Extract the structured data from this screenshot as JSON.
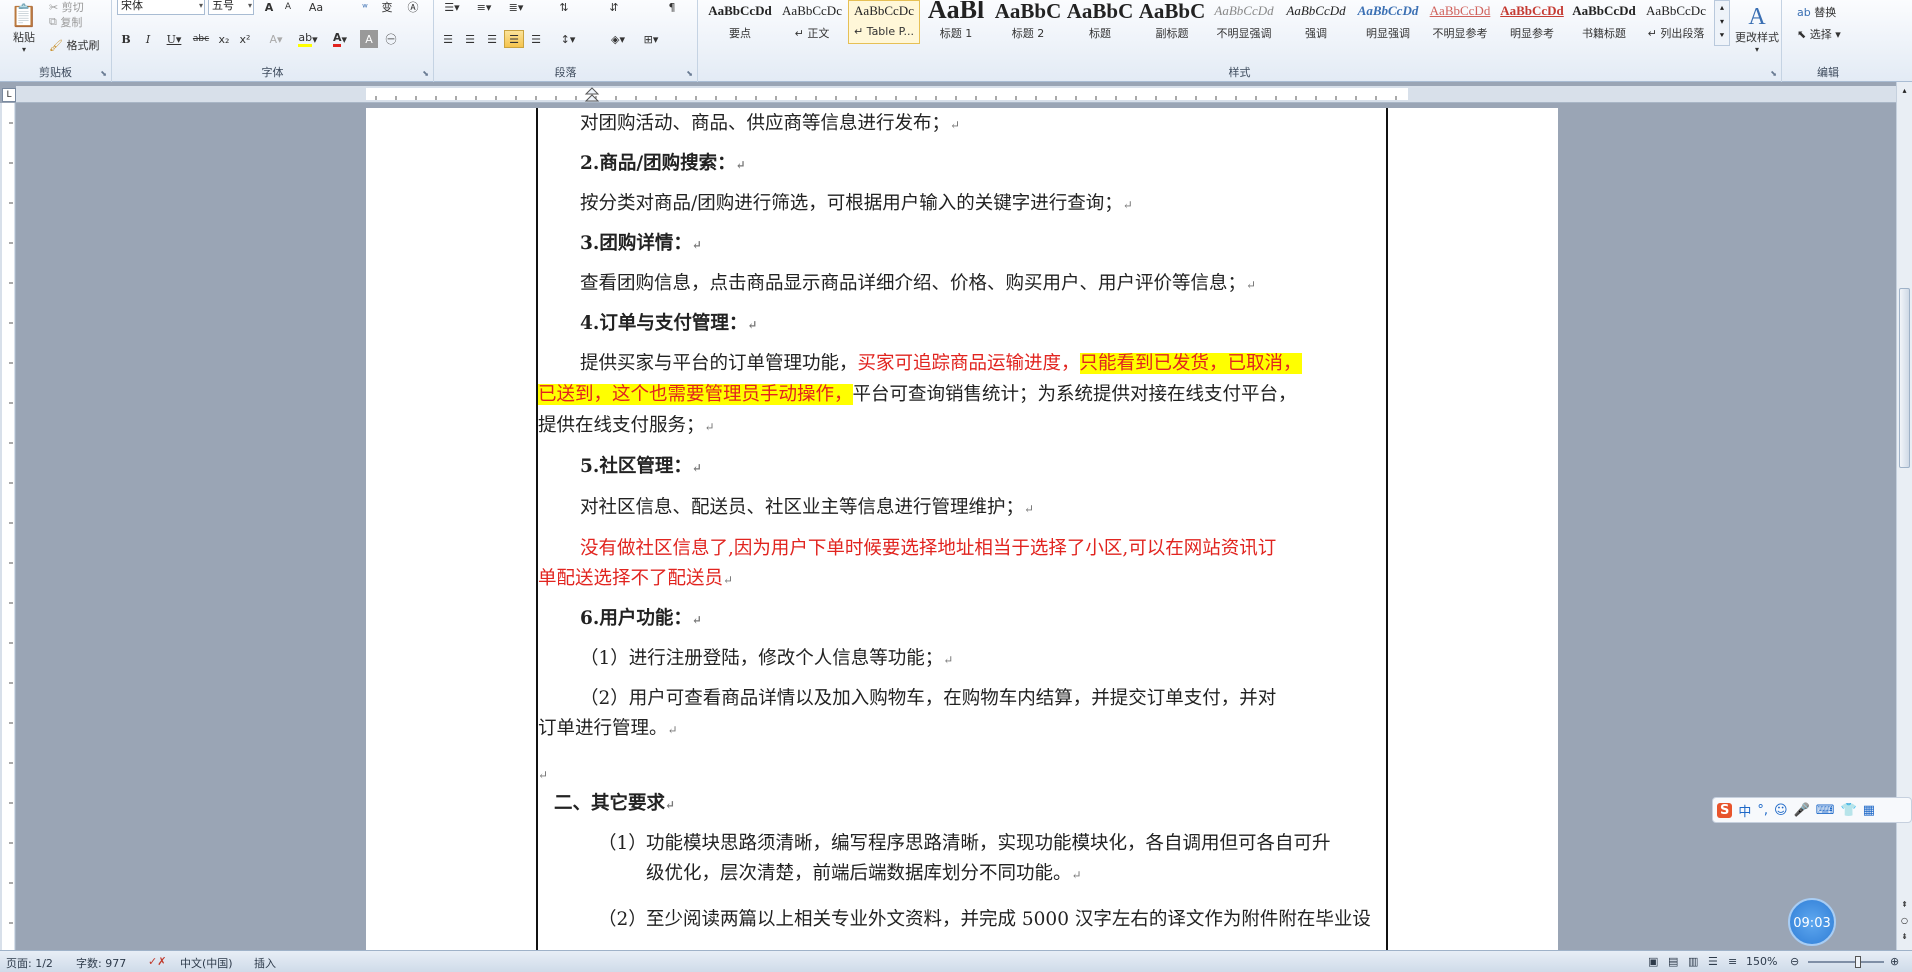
{
  "ribbon": {
    "clipboard": {
      "label": "剪贴板",
      "paste": "粘贴",
      "cut": "剪切",
      "copy": "复制",
      "format_painter": "格式刷"
    },
    "font": {
      "label": "字体",
      "family": "宋体",
      "size": "五号"
    },
    "paragraph": {
      "label": "段落"
    },
    "styles": {
      "label": "样式",
      "items": [
        {
          "preview": "AaBbCcDd",
          "name": "要点"
        },
        {
          "preview": "AaBbCcDc",
          "name": "↵ 正文"
        },
        {
          "preview": "AaBbCcDc",
          "name": "↵ Table P..."
        },
        {
          "preview": "AaBl",
          "name": "标题 1"
        },
        {
          "preview": "AaBbC",
          "name": "标题 2"
        },
        {
          "preview": "AaBbC",
          "name": "标题"
        },
        {
          "preview": "AaBbC",
          "name": "副标题"
        },
        {
          "preview": "AaBbCcDd",
          "name": "不明显强调"
        },
        {
          "preview": "AaBbCcDd",
          "name": "强调"
        },
        {
          "preview": "AaBbCcDd",
          "name": "明显强调"
        },
        {
          "preview": "AaBbCcDd",
          "name": "不明显参考"
        },
        {
          "preview": "AaBbCcDd",
          "name": "明显参考"
        },
        {
          "preview": "AaBbCcDd",
          "name": "书籍标题"
        },
        {
          "preview": "AaBbCcDc",
          "name": "↵ 列出段落"
        }
      ],
      "change_styles": "更改样式"
    },
    "editing": {
      "label": "编辑",
      "replace": "替换",
      "select": "选择"
    }
  },
  "document": {
    "lines": [
      "对团购活动、商品、供应商等信息进行发布；",
      "2.商品/团购搜索：",
      "按分类对商品/团购进行筛选，可根据用户输入的关键字进行查询；",
      "3.团购详情：",
      "查看团购信息，点击商品显示商品详细介绍、价格、购买用户、用户评价等信息；",
      "4.订单与支付管理：",
      "提供买家与平台的订单管理功能，",
      "买家可追踪商品运输进度，",
      "只能看到已发货，已取消，",
      "已送到，这个也需要管理员手动操作，",
      "平台可查询销售统计；为系统提供对接在线支付平台，",
      "提供在线支付服务；",
      "5.社区管理：",
      "对社区信息、配送员、社区业主等信息进行管理维护；",
      "没有做社区信息了,因为用户下单时候要选择地址相当于选择了小区,可以在网站资讯订",
      "单配送选择不了配送员",
      "6.用户功能：",
      "（1）进行注册登陆，修改个人信息等功能；",
      "（2）用户可查看商品详情以及加入购物车，在购物车内结算，并提交订单支付，并对",
      "订单进行管理。",
      "二、其它要求",
      "（1）",
      "功能模块思路须清晰，编写程序思路清晰，实现功能模块化，各自调用但可各自可升",
      "级优化，层次清楚，前端后端数据库划分不同功能。",
      "（2）",
      "至少阅读两篇以上相关专业外文资料，并完成 5000 汉字左右的译文作为附件附在毕业设"
    ]
  },
  "status": {
    "page": "页面: 1/2",
    "words": "字数: 977",
    "language": "中文(中国)",
    "mode": "插入",
    "zoom": "150%"
  },
  "ime": {
    "lang": "中"
  },
  "clock": "09:03",
  "colors": {
    "red": "#e1241f",
    "highlight": "#ffff00"
  }
}
